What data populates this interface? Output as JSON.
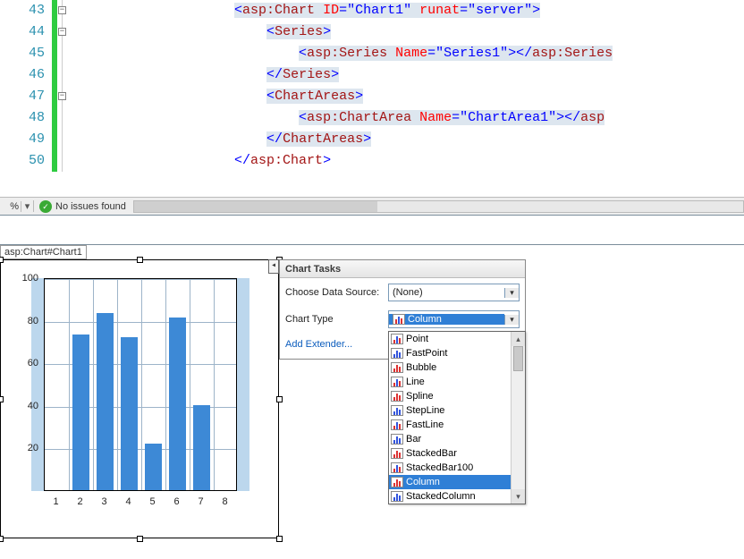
{
  "editor": {
    "lines": [
      {
        "n": "43",
        "fold": "−",
        "indent": "                    ",
        "parts": [
          [
            "punct",
            "<"
          ],
          [
            "tag",
            "asp:Chart"
          ],
          [
            "",
            ""
          ],
          [
            "attr",
            " ID"
          ],
          [
            "punct",
            "="
          ],
          [
            "val",
            "\"Chart1\""
          ],
          [
            "attr",
            " runat"
          ],
          [
            "punct",
            "="
          ],
          [
            "val",
            "\"server\""
          ],
          [
            "punct",
            ">"
          ]
        ]
      },
      {
        "n": "44",
        "fold": "−",
        "indent": "                        ",
        "parts": [
          [
            "punct",
            "<"
          ],
          [
            "tag",
            "Series"
          ],
          [
            "punct",
            ">"
          ]
        ]
      },
      {
        "n": "45",
        "fold": "",
        "indent": "                            ",
        "parts": [
          [
            "punct",
            "<"
          ],
          [
            "tag",
            "asp:Series"
          ],
          [
            "attr",
            " Name"
          ],
          [
            "punct",
            "="
          ],
          [
            "val",
            "\"Series1\""
          ],
          [
            "punct",
            "></"
          ],
          [
            "tag",
            "asp:Series"
          ]
        ]
      },
      {
        "n": "46",
        "fold": "",
        "indent": "                        ",
        "parts": [
          [
            "punct",
            "</"
          ],
          [
            "tag",
            "Series"
          ],
          [
            "punct",
            ">"
          ]
        ]
      },
      {
        "n": "47",
        "fold": "−",
        "indent": "                        ",
        "parts": [
          [
            "punct",
            "<"
          ],
          [
            "tag",
            "ChartAreas"
          ],
          [
            "punct",
            ">"
          ]
        ]
      },
      {
        "n": "48",
        "fold": "",
        "indent": "                            ",
        "parts": [
          [
            "punct",
            "<"
          ],
          [
            "tag",
            "asp:ChartArea"
          ],
          [
            "attr",
            " Name"
          ],
          [
            "punct",
            "="
          ],
          [
            "val",
            "\"ChartArea1\""
          ],
          [
            "punct",
            "></"
          ],
          [
            "tag",
            "asp"
          ]
        ]
      },
      {
        "n": "49",
        "fold": "",
        "indent": "                        ",
        "parts": [
          [
            "punct",
            "</"
          ],
          [
            "tag",
            "ChartAreas"
          ],
          [
            "punct",
            ">"
          ]
        ]
      },
      {
        "n": "50",
        "fold": "",
        "indent": "                    ",
        "parts": [
          [
            "punct",
            "</"
          ],
          [
            "tag",
            "asp:Chart"
          ],
          [
            "punct",
            ">"
          ]
        ]
      }
    ]
  },
  "status": {
    "percent": "%",
    "issues": "No issues found"
  },
  "designer": {
    "selector_label": "asp:Chart#Chart1"
  },
  "panel": {
    "title": "Chart Tasks",
    "datasource_label": "Choose Data Source:",
    "datasource_value": "(None)",
    "charttype_label": "Chart Type",
    "charttype_value": "Column",
    "add_extender": "Add Extender...",
    "options": [
      "Point",
      "FastPoint",
      "Bubble",
      "Line",
      "Spline",
      "StepLine",
      "FastLine",
      "Bar",
      "StackedBar",
      "StackedBar100",
      "Column",
      "StackedColumn"
    ],
    "selected_index": 10
  },
  "chart_data": {
    "type": "bar",
    "categories": [
      "1",
      "2",
      "3",
      "4",
      "5",
      "6",
      "7",
      "8"
    ],
    "values": [
      null,
      73,
      83,
      72,
      22,
      81,
      40,
      null
    ],
    "yticks": [
      "20",
      "40",
      "60",
      "80",
      "100"
    ],
    "xlabel": "",
    "ylabel": "",
    "ylim": [
      0,
      100
    ]
  }
}
